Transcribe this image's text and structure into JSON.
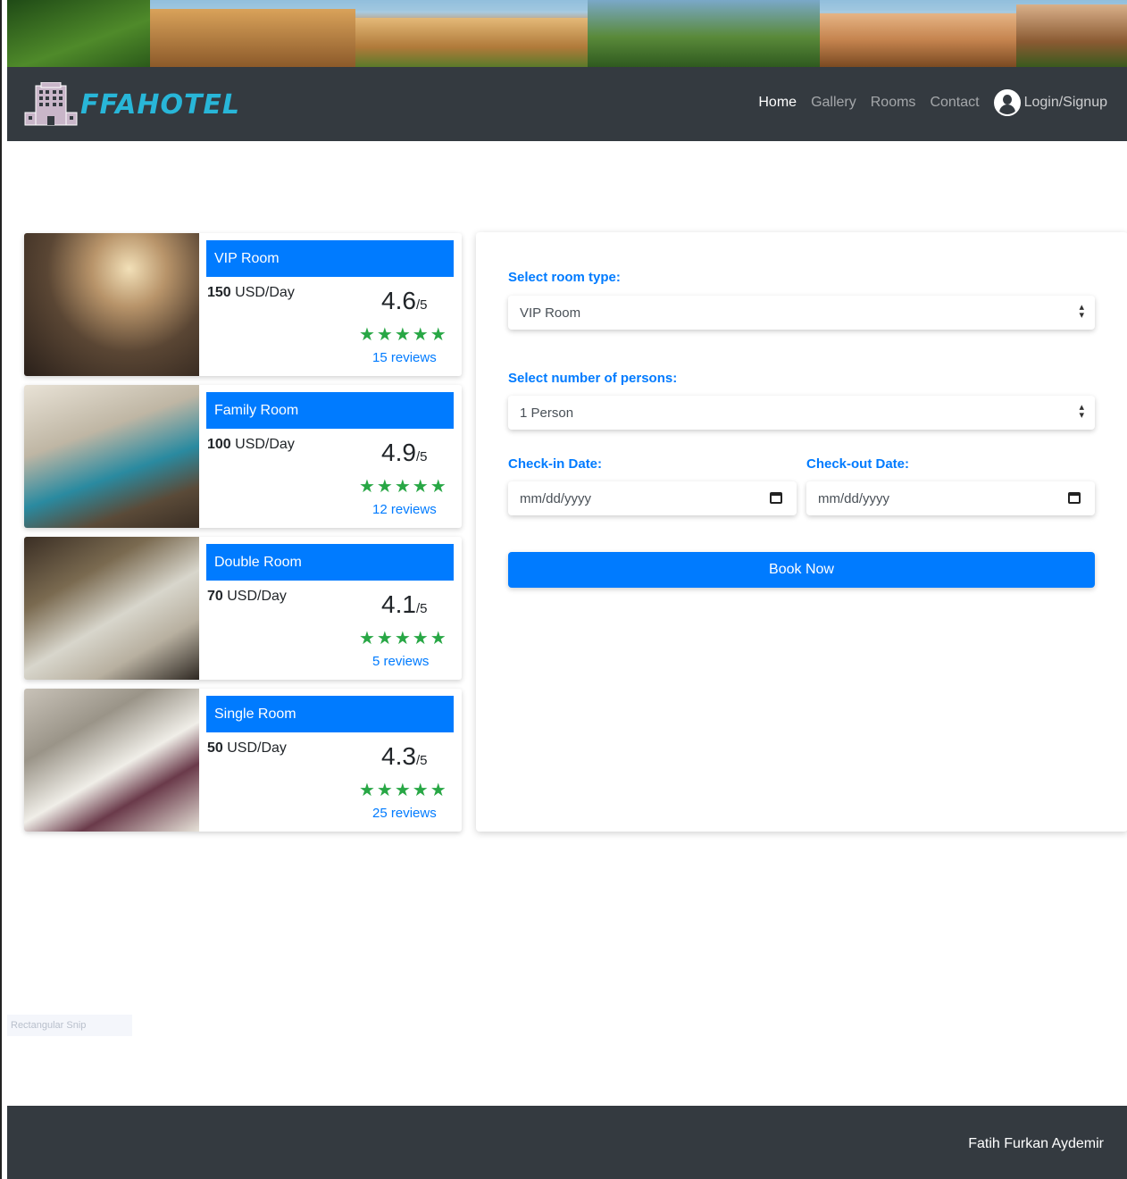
{
  "brand": {
    "name": "FFAHOTEL"
  },
  "nav": {
    "links": [
      "Home",
      "Gallery",
      "Rooms",
      "Contact"
    ],
    "login": "Login/Signup"
  },
  "rooms": [
    {
      "name": "VIP Room",
      "price": "150",
      "unit": " USD/Day",
      "rating": "4.6",
      "out_of": "/5",
      "stars": "★★★★★",
      "reviews": "15 reviews"
    },
    {
      "name": "Family Room",
      "price": "100",
      "unit": " USD/Day",
      "rating": "4.9",
      "out_of": "/5",
      "stars": "★★★★★",
      "reviews": "12 reviews"
    },
    {
      "name": "Double Room",
      "price": "70",
      "unit": " USD/Day",
      "rating": "4.1",
      "out_of": "/5",
      "stars": "★★★★★",
      "reviews": "5 reviews"
    },
    {
      "name": "Single Room",
      "price": "50",
      "unit": " USD/Day",
      "rating": "4.3",
      "out_of": "/5",
      "stars": "★★★★★",
      "reviews": "25 reviews"
    }
  ],
  "booking": {
    "room_type_label": "Select room type:",
    "room_type_value": "VIP Room",
    "persons_label": "Select number of persons:",
    "persons_value": "1 Person",
    "checkin_label": "Check-in Date:",
    "checkout_label": "Check-out Date:",
    "date_placeholder": "mm/dd/yyyy",
    "book_button": "Book Now"
  },
  "ghost_text": "Rectangular Snip",
  "footer": {
    "author": "Fatih Furkan Aydemir"
  },
  "colors": {
    "primary": "#007bff",
    "dark": "#343a40",
    "star": "#28a745",
    "brand": "#28b6d8"
  }
}
